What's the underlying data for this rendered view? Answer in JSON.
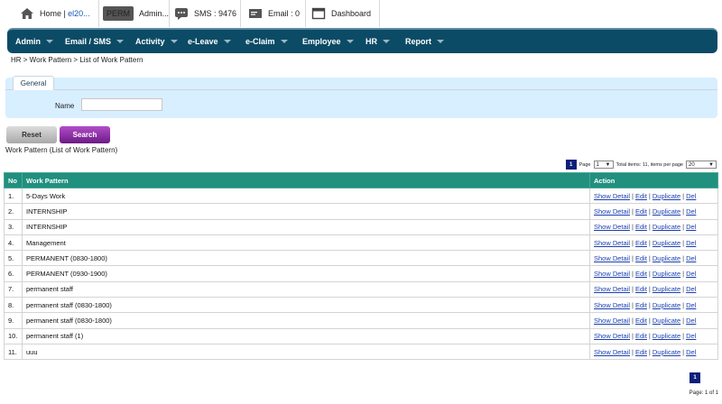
{
  "topbar": {
    "home_label": "Home |",
    "home_link": "el20...",
    "perm_badge": "PERM",
    "admin_label": "Admin...",
    "sms_label": "SMS : 9476",
    "email_label": "Email : 0",
    "dashboard_label": "Dashboard"
  },
  "nav": {
    "items": [
      {
        "label": "Admin"
      },
      {
        "label": "Email / SMS"
      },
      {
        "label": "Activity"
      },
      {
        "label": "e-Leave"
      },
      {
        "label": "e-Claim"
      },
      {
        "label": "Employee"
      },
      {
        "label": "HR"
      },
      {
        "label": "Report"
      }
    ]
  },
  "breadcrumb": "HR > Work Pattern > List of Work Pattern",
  "filter": {
    "tab_label": "General",
    "name_label": "Name",
    "name_value": "",
    "reset_label": "Reset",
    "search_label": "Search"
  },
  "section_title": "Work Pattern (List of Work Pattern)",
  "pager": {
    "current_page": "1",
    "page_label": "Page",
    "page_select": "1",
    "total_text": "Total items: 11, items per page",
    "per_page": "20",
    "page_info": "Page: 1 of 1"
  },
  "table": {
    "headers": [
      "No",
      "Work Pattern",
      "Action"
    ],
    "actions": [
      "Show Detail",
      "Edit",
      "Duplicate",
      "Del"
    ],
    "rows": [
      {
        "no": "1.",
        "name": "5-Days Work"
      },
      {
        "no": "2.",
        "name": "INTERNSHIP"
      },
      {
        "no": "3.",
        "name": "INTERNSHIP"
      },
      {
        "no": "4.",
        "name": "Management"
      },
      {
        "no": "5.",
        "name": "PERMANENT (0830-1800)"
      },
      {
        "no": "6.",
        "name": "PERMANENT (0930-1900)"
      },
      {
        "no": "7.",
        "name": "permanent staff"
      },
      {
        "no": "8.",
        "name": "permanent staff (0830-1800)"
      },
      {
        "no": "9.",
        "name": "permanent staff (0830-1800)"
      },
      {
        "no": "10.",
        "name": "permanent staff (1)"
      },
      {
        "no": "11.",
        "name": "uuu"
      }
    ]
  }
}
